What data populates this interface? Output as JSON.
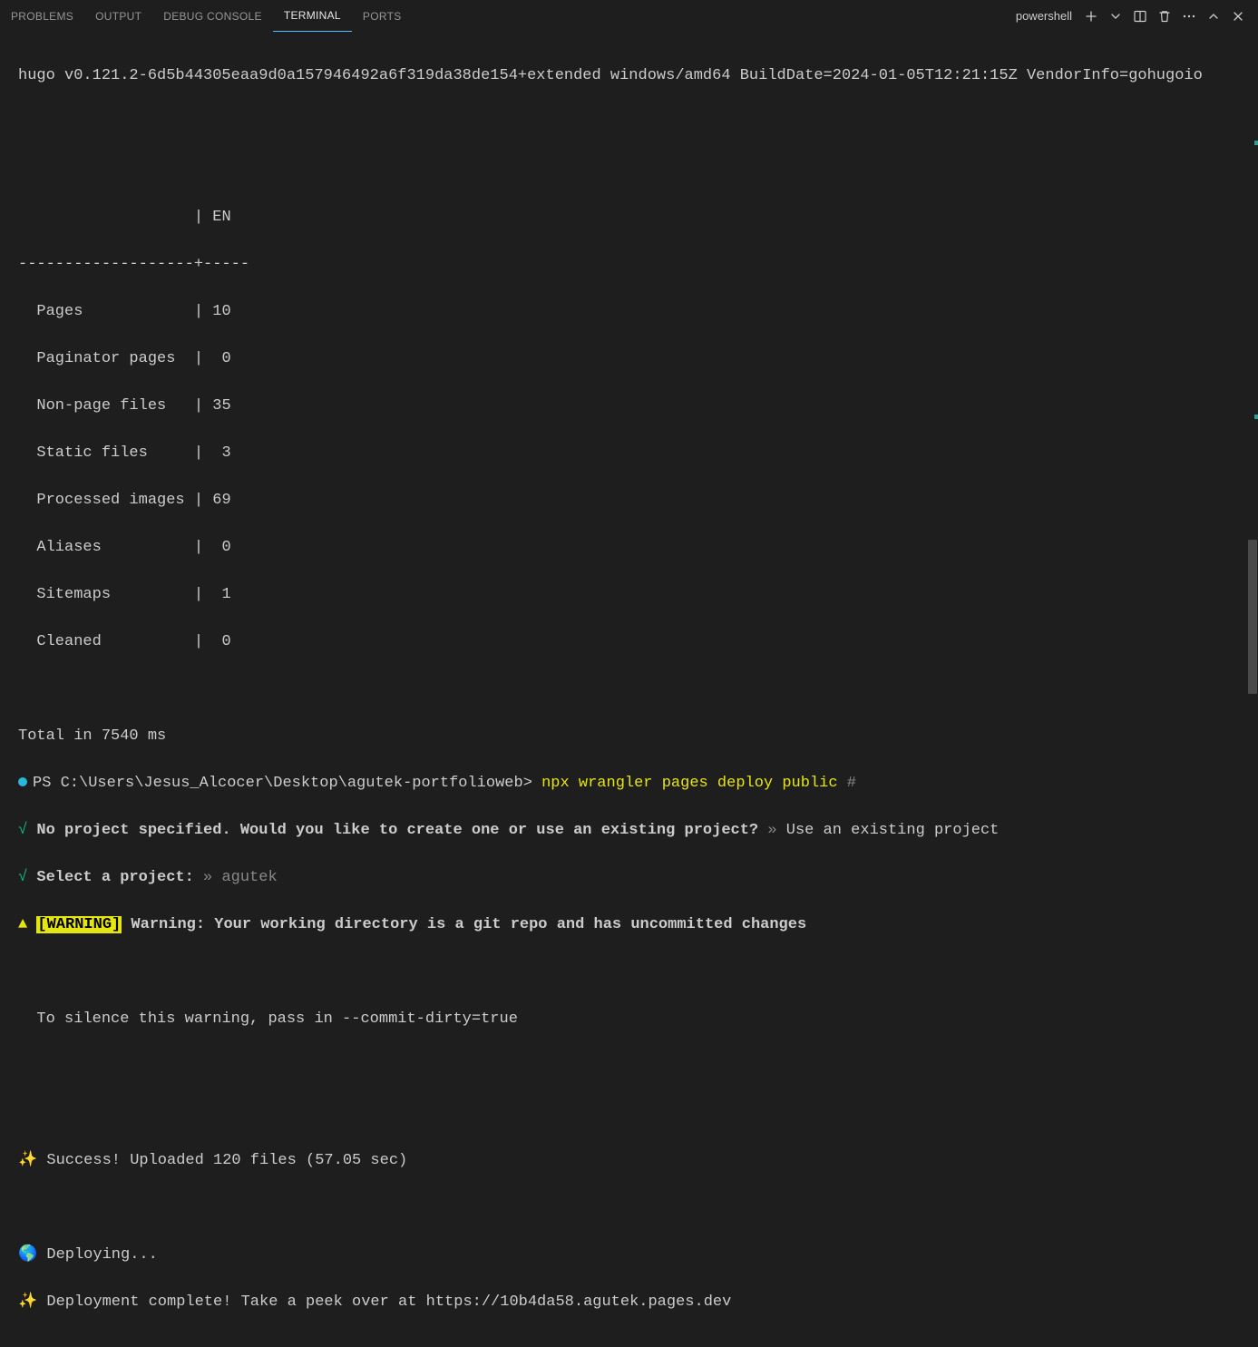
{
  "tabs": {
    "problems": "PROBLEMS",
    "output": "OUTPUT",
    "debug": "DEBUG CONSOLE",
    "terminal": "TERMINAL",
    "ports": "PORTS"
  },
  "header": {
    "shell": "powershell"
  },
  "terminal": {
    "hugoLine": "hugo v0.121.2-6d5b44305eaa9d0a157946492a6f319da38de154+extended windows/amd64 BuildDate=2024-01-05T12:21:15Z VendorInfo=gohugoio",
    "tableHeader": "                   | EN  ",
    "tableSep": "-------------------+-----",
    "rows": [
      "  Pages            | 10  ",
      "  Paginator pages  |  0  ",
      "  Non-page files   | 35  ",
      "  Static files     |  3  ",
      "  Processed images | 69  ",
      "  Aliases          |  0  ",
      "  Sitemaps         |  1  ",
      "  Cleaned          |  0  "
    ],
    "total": "Total in 7540 ms",
    "promptPath": "PS C:\\Users\\Jesus_Alcocer\\Desktop\\agutek-portfolioweb> ",
    "promptCmd": "npx wrangler pages deploy public ",
    "promptHash": "#",
    "check": "√",
    "q1bold": " No project specified. Would you like to create one or use an existing project?",
    "q1Arrow": " » ",
    "q1Answer": "Use an existing project",
    "q2bold": " Select a project:",
    "q2ArrowAns": " » agutek",
    "warnTri": "▲ ",
    "warnTag": "[WARNING]",
    "warnText": " Warning: Your working directory is a git repo and has uncommitted changes",
    "silence": "  To silence this warning, pass in --commit-dirty=true",
    "sparkle": "✨",
    "success": " Success! Uploaded 120 files (57.05 sec)",
    "globe": "🌎",
    "deploying": " Deploying...",
    "complete": " Deployment complete! Take a peek over at https://10b4da58.agutek.pages.dev"
  }
}
